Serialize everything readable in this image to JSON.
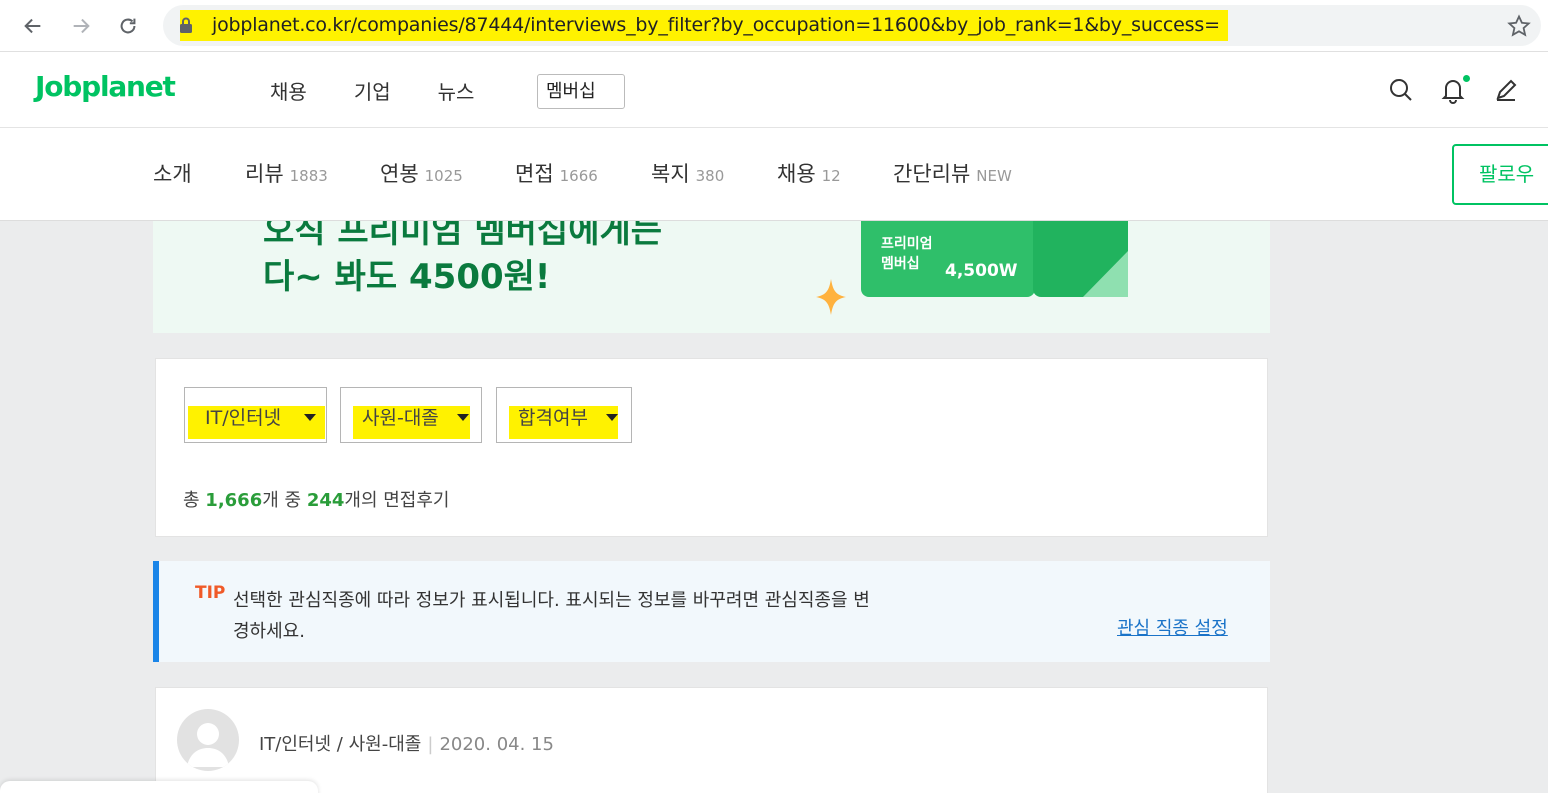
{
  "browser": {
    "url": "jobplanet.co.kr/companies/87444/interviews_by_filter?by_occupation=11600&by_job_rank=1&by_success="
  },
  "header": {
    "logo": "Jobplanet",
    "nav": [
      "채용",
      "기업",
      "뉴스"
    ],
    "membership_label": "멤버십",
    "accent_color": "#00c362"
  },
  "tabs": [
    {
      "label": "소개",
      "count": ""
    },
    {
      "label": "리뷰",
      "count": "1883"
    },
    {
      "label": "연봉",
      "count": "1025"
    },
    {
      "label": "면접",
      "count": "1666"
    },
    {
      "label": "복지",
      "count": "380"
    },
    {
      "label": "채용",
      "count": "12"
    },
    {
      "label": "간단리뷰",
      "count": "NEW"
    }
  ],
  "follow_label": "팔로우",
  "banner": {
    "line1": "오직 프리미엄 멤버십에게는",
    "line2": "다~ 봐도 4500원!",
    "ticket_title_1": "프리미엄",
    "ticket_title_2": "멤버십",
    "ticket_price": "4,500W"
  },
  "filters": {
    "occupation": "IT/인터넷",
    "job_rank": "사원-대졸",
    "success": "합격여부"
  },
  "count": {
    "prefix": "총 ",
    "total": "1,666",
    "middle": "개 중 ",
    "filtered": "244",
    "suffix": "개의 면접후기"
  },
  "tip": {
    "label": "TIP",
    "text": "선택한 관심직종에 따라 정보가 표시됩니다. 표시되는 정보를 바꾸려면 관심직종을 변경하세요.",
    "link": "관심 직종 설정"
  },
  "review": {
    "occupation": "IT/인터넷",
    "slash": "/",
    "job_rank": "사원-대졸",
    "separator": "|",
    "date": "2020. 04. 15"
  }
}
